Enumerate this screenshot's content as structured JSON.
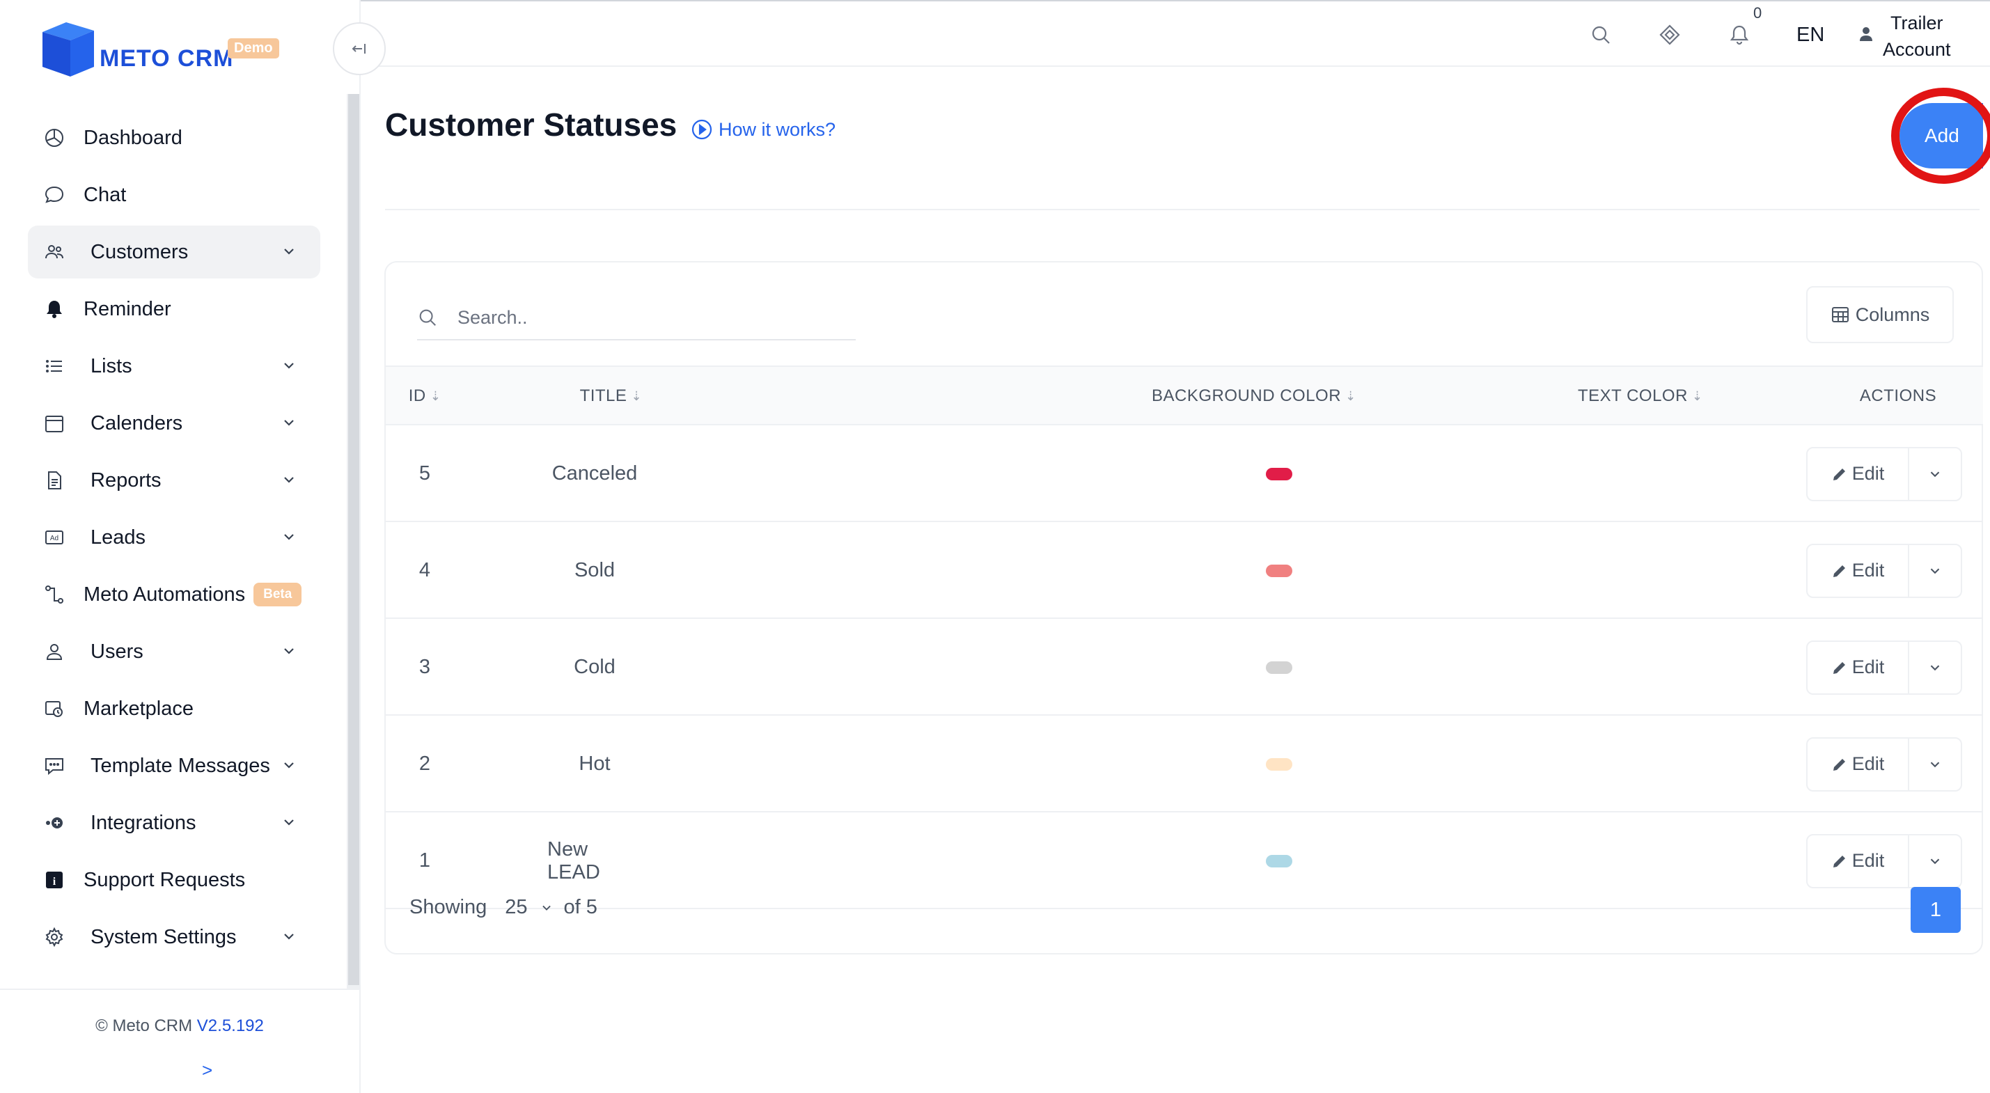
{
  "brand": {
    "name": "METO CRM",
    "badge": "Demo",
    "primary_color": "#3b82f6"
  },
  "sidebar": {
    "items": [
      {
        "label": "Dashboard",
        "icon": "dashboard-icon"
      },
      {
        "label": "Chat",
        "icon": "chat-icon"
      },
      {
        "label": "Customers",
        "icon": "customers-icon",
        "active": true,
        "expandable": true
      },
      {
        "label": "Reminder",
        "icon": "bell-icon"
      },
      {
        "label": "Lists",
        "icon": "list-icon",
        "expandable": true
      },
      {
        "label": "Calenders",
        "icon": "calendar-icon",
        "expandable": true
      },
      {
        "label": "Reports",
        "icon": "report-icon",
        "expandable": true
      },
      {
        "label": "Leads",
        "icon": "ad-icon",
        "expandable": true
      },
      {
        "label": "Meto Automations",
        "icon": "automation-icon",
        "badge": "Beta"
      },
      {
        "label": "Users",
        "icon": "user-icon",
        "expandable": true
      },
      {
        "label": "Marketplace",
        "icon": "marketplace-icon"
      },
      {
        "label": "Template Messages",
        "icon": "template-icon",
        "expandable": true
      },
      {
        "label": "Integrations",
        "icon": "integrations-icon",
        "expandable": true
      },
      {
        "label": "Support Requests",
        "icon": "info-icon"
      },
      {
        "label": "System Settings",
        "icon": "gear-icon",
        "expandable": true
      }
    ],
    "footer": {
      "copyright": "© Meto CRM",
      "version": "V2.5.192",
      "expand_symbol": ">"
    }
  },
  "topbar": {
    "notification_count": "0",
    "language": "EN",
    "account_line1": "Trailer",
    "account_line2": "Account"
  },
  "page": {
    "title": "Customer Statuses",
    "help_link": "How it works?",
    "add_button": "Add"
  },
  "table": {
    "search_placeholder": "Search..",
    "columns_button": "Columns",
    "headers": {
      "id": "ID",
      "title": "TITLE",
      "background_color": "BACKGROUND COLOR",
      "text_color": "TEXT COLOR",
      "actions": "ACTIONS"
    },
    "edit_label": "Edit",
    "rows": [
      {
        "id": "5",
        "title": "Canceled",
        "bg_color": "#e11d48",
        "text_color": "#000000"
      },
      {
        "id": "4",
        "title": "Sold",
        "bg_color": "#f08080",
        "text_color": "#000000"
      },
      {
        "id": "3",
        "title": "Cold",
        "bg_color": "#d3d3d3",
        "text_color": "#000000"
      },
      {
        "id": "2",
        "title": "Hot",
        "bg_color": "#ffe4c4",
        "text_color": "#000000"
      },
      {
        "id": "1",
        "title": "New LEAD",
        "bg_color": "#add8e6",
        "text_color": "#000000"
      }
    ],
    "footer": {
      "showing_label": "Showing",
      "per_page": "25",
      "of_total": "of 5",
      "current_page": "1"
    }
  }
}
